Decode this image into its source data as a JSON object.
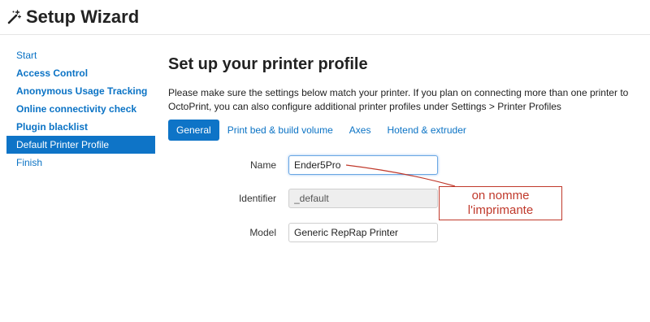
{
  "header": {
    "title": "Setup Wizard",
    "icon": "magic-wand-icon"
  },
  "sidebar": {
    "items": [
      {
        "label": "Start"
      },
      {
        "label": "Access Control"
      },
      {
        "label": "Anonymous Usage Tracking"
      },
      {
        "label": "Online connectivity check"
      },
      {
        "label": "Plugin blacklist"
      },
      {
        "label": "Default Printer Profile"
      },
      {
        "label": "Finish"
      }
    ],
    "active_index": 5
  },
  "main": {
    "title": "Set up your printer profile",
    "intro": "Please make sure the settings below match your printer. If you plan on connecting more than one printer to OctoPrint, you can also configure additional printer profiles under Settings > Printer Profiles",
    "tabs": [
      {
        "label": "General"
      },
      {
        "label": "Print bed & build volume"
      },
      {
        "label": "Axes"
      },
      {
        "label": "Hotend & extruder"
      }
    ],
    "active_tab": 0
  },
  "form": {
    "name_label": "Name",
    "name_value": "Ender5Pro",
    "identifier_label": "Identifier",
    "identifier_value": "_default",
    "model_label": "Model",
    "model_value": "Generic RepRap Printer"
  },
  "annotation": {
    "line1": "on nomme",
    "line2": "l'imprimante",
    "color": "#c0392b"
  },
  "colors": {
    "accent": "#0e74c7",
    "link": "#0b73c5"
  }
}
